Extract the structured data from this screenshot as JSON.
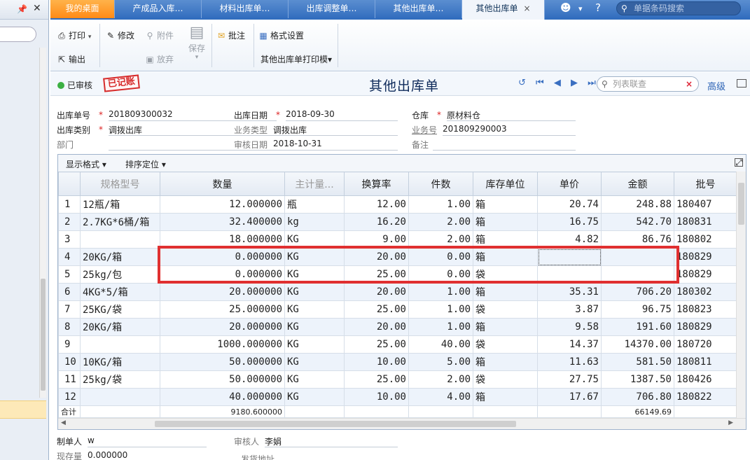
{
  "left_panel": {
    "pin": "📌",
    "close": "✕"
  },
  "tabs": [
    {
      "label": "我的桌面"
    },
    {
      "label": "产成品入库…"
    },
    {
      "label": "材料出库单…"
    },
    {
      "label": "出库调整单…"
    },
    {
      "label": "其他出库单…"
    },
    {
      "label": "其他出库单",
      "close": "×"
    }
  ],
  "top_search": {
    "placeholder": "单据条码搜索"
  },
  "toolbar": {
    "print": "打印",
    "export": "输出",
    "modify": "修改",
    "attach": "附件",
    "discard": "放弃",
    "save": "保存",
    "annotate": "批注",
    "format": "格式设置",
    "template": "其他出库单打印模▾"
  },
  "header": {
    "status": "已审核",
    "stamp": "已记账",
    "title": "其他出库单",
    "search_placeholder": "列表联查",
    "advanced": "高级"
  },
  "form": {
    "doc_no_label": "出库单号",
    "doc_no": "201809300032",
    "date_label": "出库日期",
    "date": "2018-09-30",
    "warehouse_label": "仓库",
    "warehouse": "原材料仓",
    "type_label": "出库类别",
    "type": "调拨出库",
    "biz_type_label": "业务类型",
    "biz_type": "调拨出库",
    "biz_no_label": "业务号",
    "biz_no": "201809290003",
    "dept_label": "部门",
    "dept": "",
    "audit_date_label": "审核日期",
    "audit_date": "2018-10-31",
    "remark_label": "备注",
    "remark": ""
  },
  "grid": {
    "toolbar": {
      "display": "显示格式 ▾",
      "sort": "排序定位 ▾"
    },
    "columns": [
      "",
      "规格型号",
      "数量",
      "主计量...",
      "换算率",
      "件数",
      "库存单位",
      "单价",
      "金额",
      "批号"
    ],
    "rows": [
      [
        "1",
        "12瓶/箱",
        "12.000000",
        "瓶",
        "12.00",
        "1.00",
        "箱",
        "20.74",
        "248.88",
        "180407"
      ],
      [
        "2",
        "2.7KG*6桶/箱",
        "32.400000",
        "kg",
        "16.20",
        "2.00",
        "箱",
        "16.75",
        "542.70",
        "180831"
      ],
      [
        "3",
        "",
        "18.000000",
        "KG",
        "9.00",
        "2.00",
        "箱",
        "4.82",
        "86.76",
        "180802"
      ],
      [
        "4",
        "20KG/箱",
        "0.000000",
        "KG",
        "20.00",
        "0.00",
        "箱",
        "",
        "",
        "180829"
      ],
      [
        "5",
        "25kg/包",
        "0.000000",
        "KG",
        "25.00",
        "0.00",
        "袋",
        "",
        "",
        "180829"
      ],
      [
        "6",
        "4KG*5/箱",
        "20.000000",
        "KG",
        "20.00",
        "1.00",
        "箱",
        "35.31",
        "706.20",
        "180302"
      ],
      [
        "7",
        "25KG/袋",
        "25.000000",
        "KG",
        "25.00",
        "1.00",
        "袋",
        "3.87",
        "96.75",
        "180823"
      ],
      [
        "8",
        "20KG/箱",
        "20.000000",
        "KG",
        "20.00",
        "1.00",
        "箱",
        "9.58",
        "191.60",
        "180829"
      ],
      [
        "9",
        "",
        "1000.000000",
        "KG",
        "25.00",
        "40.00",
        "袋",
        "14.37",
        "14370.00",
        "180720"
      ],
      [
        "10",
        "10KG/箱",
        "50.000000",
        "KG",
        "10.00",
        "5.00",
        "箱",
        "11.63",
        "581.50",
        "180811"
      ],
      [
        "11",
        "25kg/袋",
        "50.000000",
        "KG",
        "25.00",
        "2.00",
        "袋",
        "27.75",
        "1387.50",
        "180426"
      ],
      [
        "12",
        "",
        "40.000000",
        "KG",
        "10.00",
        "4.00",
        "箱",
        "17.67",
        "706.80",
        "180822"
      ]
    ],
    "sum": {
      "label": "合计",
      "qty": "9180.600000",
      "amount": "66149.69"
    }
  },
  "footer": {
    "maker_label": "制单人",
    "maker": "w",
    "auditor_label": "审核人",
    "auditor": "李娟",
    "stock_label": "现存量",
    "stock": "0.000000",
    "ship_label": "发货地址"
  }
}
